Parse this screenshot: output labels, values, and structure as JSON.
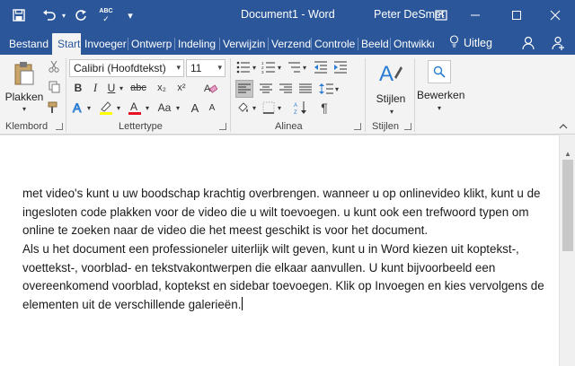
{
  "titlebar": {
    "title": "Document1 - Word",
    "user": "Peter DeSmet",
    "bg_color": "#2b579a"
  },
  "quick_access": {
    "save_icon": "save-icon",
    "undo_icon": "undo-icon",
    "redo_icon": "redo-icon",
    "spelling_label": "ABC",
    "customize_icon": "chevron-down-icon"
  },
  "tabs": [
    {
      "label": "Bestand"
    },
    {
      "label": "Start"
    },
    {
      "label": "Invoeger"
    },
    {
      "label": "Ontwerp"
    },
    {
      "label": "Indeling"
    },
    {
      "label": "Verwijzin"
    },
    {
      "label": "Verzendl"
    },
    {
      "label": "Controle"
    },
    {
      "label": "Beeld"
    },
    {
      "label": "Ontwikkı"
    }
  ],
  "tellme": {
    "label": "Uitleg"
  },
  "ribbon": {
    "clipboard": {
      "paste_label": "Plakken",
      "group_label": "Klembord"
    },
    "font": {
      "font_name": "Calibri (Hoofdtekst)",
      "font_size": "11",
      "group_label": "Lettertype",
      "bold": "B",
      "italic": "I",
      "underline": "U",
      "strike": "abc",
      "subscript": "x₂",
      "superscript": "x²",
      "grow": "A",
      "shrink": "A",
      "case": "Aa",
      "highlight_color": "#ffff00",
      "font_color": "#e81123"
    },
    "paragraph": {
      "group_label": "Alinea"
    },
    "styles": {
      "label": "Stijlen",
      "group_label": "Stijlen"
    },
    "editing": {
      "label": "Bewerken"
    }
  },
  "document": {
    "paragraphs": [
      "met video's kunt u uw boodschap krachtig overbrengen. wanneer u op onlinevideo klikt, kunt u de ingesloten code plakken voor de video die u wilt toevoegen. u kunt ook een trefwoord typen om online te zoeken naar de video die het meest geschikt is voor het document.",
      "Als u het document een professioneler uiterlijk wilt geven, kunt u in Word kiezen uit koptekst-, voettekst-, voorblad- en tekstvakontwerpen die elkaar aanvullen. U kunt bijvoorbeeld een overeenkomend voorblad, koptekst en sidebar toevoegen. Klik op Invoegen en kies vervolgens de elementen uit de verschillende galerieën."
    ]
  }
}
